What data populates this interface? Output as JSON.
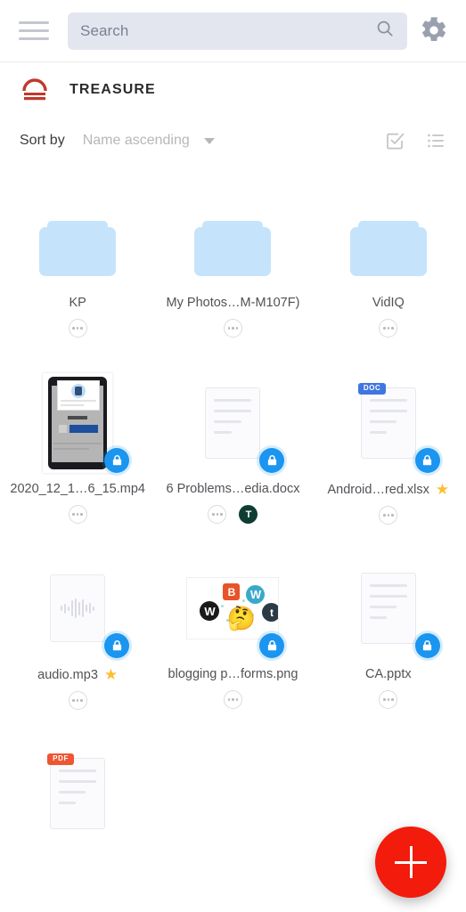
{
  "topbar": {
    "menu_icon": "hamburger-menu-icon",
    "search": {
      "placeholder": "Search",
      "value": "",
      "icon": "search-icon"
    },
    "settings_icon": "gear-icon"
  },
  "header": {
    "logo_icon": "treasure-logo-icon",
    "title": "TREASURE"
  },
  "sortbar": {
    "label": "Sort by",
    "value": "Name ascending",
    "caret_icon": "chevron-down-icon",
    "select_icon": "checkbox-check-icon",
    "view_icon": "list-view-icon"
  },
  "colors": {
    "accent_red": "#f21b0c",
    "lock_blue": "#1a95f0",
    "folder_blue": "#c5e4fb",
    "star_yellow": "#fbc02d",
    "search_bg": "#e3e6ef",
    "tag_green": "#0f3d33",
    "doc_badge_blue": "#3f76e0",
    "pdf_badge_red": "#ef5533"
  },
  "items": [
    {
      "name": "KP",
      "kind": "folder",
      "locked": false,
      "starred": false,
      "menu_icon": "overflow-menu-icon",
      "tag": null
    },
    {
      "name": "My Photos…M-M107F)",
      "kind": "folder",
      "locked": false,
      "starred": false,
      "menu_icon": "overflow-menu-icon",
      "tag": null
    },
    {
      "name": "VidIQ",
      "kind": "folder",
      "locked": false,
      "starred": false,
      "menu_icon": "overflow-menu-icon",
      "tag": null
    },
    {
      "name": "2020_12_1…6_15.mp4",
      "kind": "video",
      "locked": true,
      "starred": false,
      "menu_icon": "overflow-menu-icon",
      "tag": null
    },
    {
      "name": "6 Problems…edia.docx",
      "kind": "doc",
      "locked": true,
      "starred": false,
      "menu_icon": "overflow-menu-icon",
      "tag": "T"
    },
    {
      "name": "Android…red.xlsx",
      "kind": "doc-doc",
      "locked": true,
      "starred": true,
      "menu_icon": "overflow-menu-icon",
      "tag": null
    },
    {
      "name": "audio.mp3",
      "kind": "audio",
      "locked": true,
      "starred": true,
      "menu_icon": "overflow-menu-icon",
      "tag": null
    },
    {
      "name": "blogging p…forms.png",
      "kind": "image",
      "locked": true,
      "starred": false,
      "menu_icon": "overflow-menu-icon",
      "tag": null
    },
    {
      "name": "CA.pptx",
      "kind": "doc",
      "locked": true,
      "starred": false,
      "menu_icon": "overflow-menu-icon",
      "tag": null
    },
    {
      "name": "",
      "kind": "pdf",
      "locked": false,
      "starred": false,
      "menu_icon": null,
      "tag": null
    }
  ],
  "badges": {
    "doc": "DOC",
    "pdf": "PDF"
  },
  "fab": {
    "label": "+",
    "icon": "plus-icon"
  }
}
